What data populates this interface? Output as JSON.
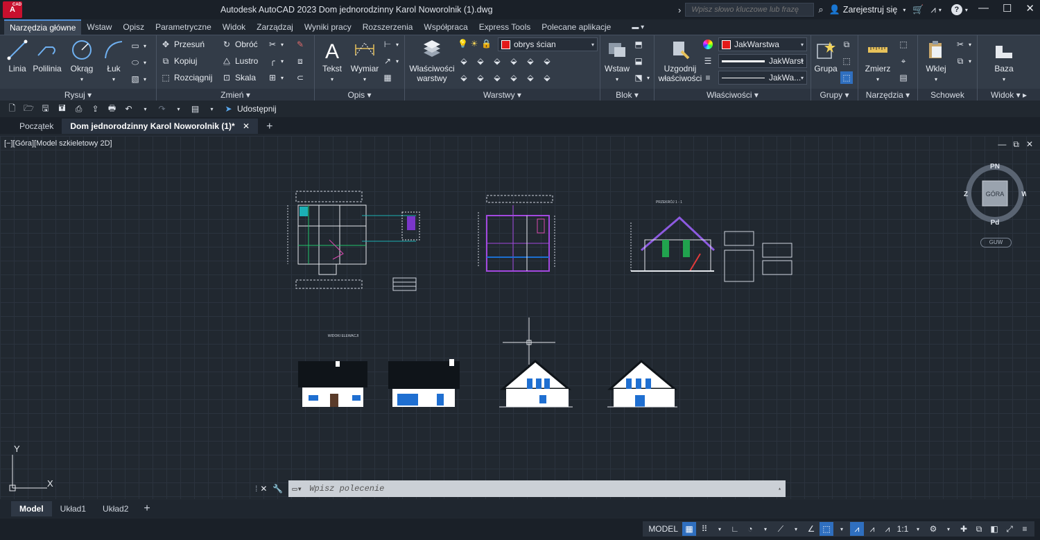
{
  "titlebar": {
    "logo_text": "A",
    "logo_sub": "CAD",
    "title": "Autodesk AutoCAD 2023    Dom jednorodzinny Karol Noworolnik (1).dwg",
    "search_placeholder": "Wpisz słowo kluczowe lub frazę",
    "sign_in": "Zarejestruj się"
  },
  "ribbon_tabs": [
    "Narzędzia główne",
    "Wstaw",
    "Opisz",
    "Parametryczne",
    "Widok",
    "Zarządzaj",
    "Wyniki pracy",
    "Rozszerzenia",
    "Współpraca",
    "Express Tools",
    "Polecane aplikacje"
  ],
  "ribbon": {
    "draw": {
      "label": "Rysuj",
      "linia": "Linia",
      "polilinia": "Polilinia",
      "okrag": "Okrąg",
      "luk": "Łuk"
    },
    "modify": {
      "label": "Zmień",
      "przesun": "Przesuń",
      "obroc": "Obróć",
      "kopiuj": "Kopiuj",
      "lustro": "Lustro",
      "rozciagnij": "Rozciągnij",
      "skala": "Skala"
    },
    "annotation": {
      "label": "Opis",
      "tekst": "Tekst",
      "wymiar": "Wymiar"
    },
    "layers": {
      "label": "Warstwy",
      "properties": "Właściwości warstwy",
      "current_layer": "obrys ścian"
    },
    "block": {
      "label": "Blok",
      "wstaw": "Wstaw"
    },
    "properties": {
      "label": "Właściwości",
      "match": "Uzgodnij właściwości",
      "color": "JakWarstwa",
      "linetype": "JakWarst",
      "lineweight": "JakWa..."
    },
    "groups": {
      "label": "Grupy",
      "grupa": "Grupa"
    },
    "utilities": {
      "label": "Narzędzia",
      "zmierz": "Zmierz"
    },
    "clipboard": {
      "label": "Schowek",
      "wklej": "Wklej"
    },
    "view": {
      "label": "Widok",
      "baza": "Baza"
    }
  },
  "qat": {
    "share": "Udostępnij"
  },
  "doc_tabs": [
    "Początek",
    "Dom jednorodzinny Karol Noworolnik (1)*"
  ],
  "viewport": {
    "label": "[−][Góra][Model szkieletowy 2D]",
    "viewcube": {
      "top": "GÓRA",
      "n": "PN",
      "s": "Pd",
      "e": "W",
      "w": "Z"
    },
    "wcs": "GUW",
    "drawing_title_section": "PRZEKRÓJ 1 - 1",
    "drawing_title_elevations": "WIDOKI ELEWACJI",
    "ucs_x": "X",
    "ucs_y": "Y"
  },
  "command": {
    "placeholder": "Wpisz polecenie"
  },
  "layout_tabs": [
    "Model",
    "Układ1",
    "Układ2"
  ],
  "status": {
    "model": "MODEL",
    "scale": "1:1"
  }
}
